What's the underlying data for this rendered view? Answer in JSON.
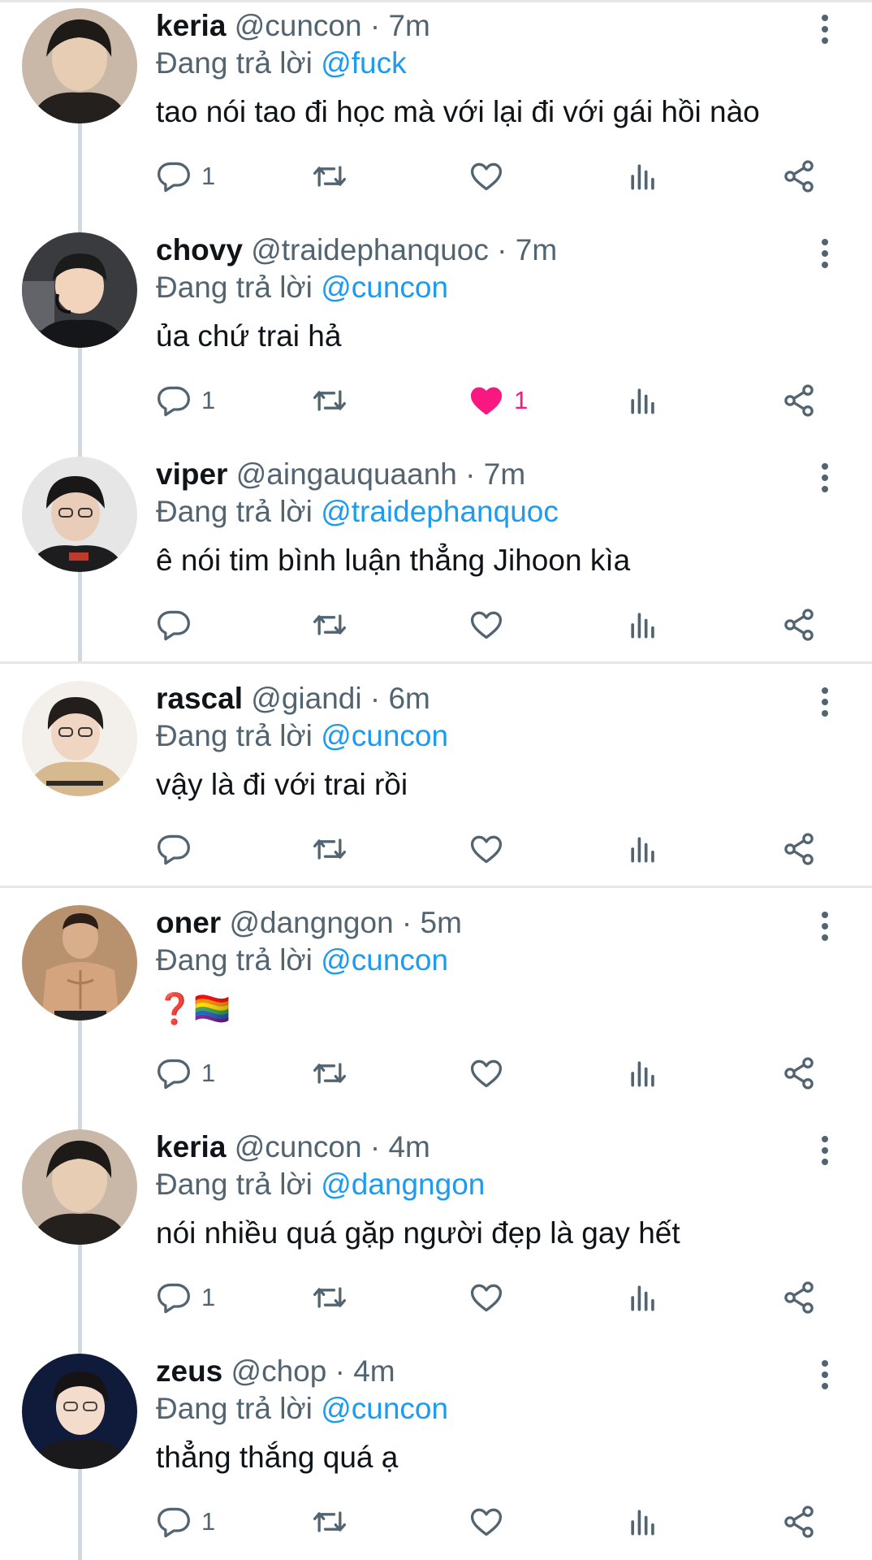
{
  "labels": {
    "replying_prefix": "Đang trả lời",
    "dot": " · "
  },
  "colors": {
    "accent": "#1d9bf0",
    "like": "#f91880",
    "muted": "#536471"
  },
  "icons": [
    "reply-icon",
    "retweet-icon",
    "like-icon",
    "analytics-icon",
    "share-icon",
    "more-icon"
  ],
  "tweets": [
    {
      "name": "keria",
      "handle": "@cuncon",
      "time": "7m",
      "reply_to": "@fuck",
      "text": "tao nói tao đi học mà với lại đi với gái hồi nào",
      "replies": "1",
      "likes": "",
      "liked": false
    },
    {
      "name": "chovy",
      "handle": "@traidephanquoc",
      "time": "7m",
      "reply_to": "@cuncon",
      "text": "ủa chứ trai hả",
      "replies": "1",
      "likes": "1",
      "liked": true
    },
    {
      "name": "viper",
      "handle": "@aingauquaanh",
      "time": "7m",
      "reply_to": "@traidephanquoc",
      "text": "ê nói tim bình luận thẳng Jihoon kìa",
      "replies": "",
      "likes": "",
      "liked": false
    },
    {
      "name": "rascal",
      "handle": "@giandi",
      "time": "6m",
      "reply_to": "@cuncon",
      "text": "vậy là đi với trai rồi",
      "replies": "",
      "likes": "",
      "liked": false
    },
    {
      "name": "oner",
      "handle": "@dangngon",
      "time": "5m",
      "reply_to": "@cuncon",
      "text": "❓🏳️‍🌈",
      "replies": "1",
      "likes": "",
      "liked": false
    },
    {
      "name": "keria",
      "handle": "@cuncon",
      "time": "4m",
      "reply_to": "@dangngon",
      "text": "nói nhiều quá gặp người đẹp là gay hết",
      "replies": "1",
      "likes": "",
      "liked": false
    },
    {
      "name": "zeus",
      "handle": "@chop",
      "time": "4m",
      "reply_to": "@cuncon",
      "text": "thẳng thắng quá ạ",
      "replies": "1",
      "likes": "",
      "liked": false
    }
  ]
}
